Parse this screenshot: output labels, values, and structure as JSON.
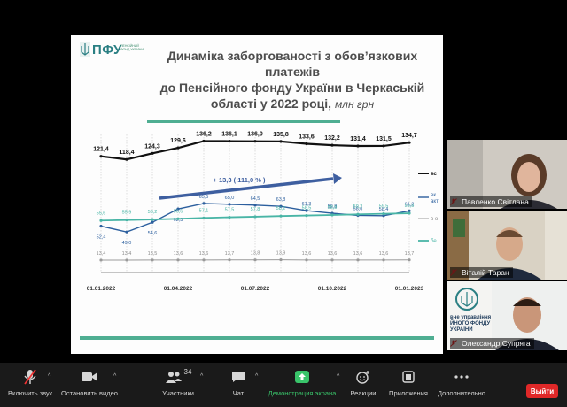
{
  "slide": {
    "logo": {
      "abbr": "ПФУ",
      "subtitle": "ПЕНСІЙНИЙ ФОНД УКРАЇНИ"
    },
    "title_line1": "Динаміка заборгованості з обов’язкових платежів",
    "title_line2": "до Пенсійного фонду України в Черкаській",
    "title_line3_main": "області у 2022 році,",
    "title_line3_unit": "млн грн",
    "growth_annotation": "+ 13,3  ( 111,0 % )",
    "legend_visible": [
      "вс",
      "ек",
      "акт",
      "в о",
      "бе"
    ]
  },
  "chart_data": {
    "type": "line",
    "x_tick_labels": [
      "01.01.2022",
      "01.04.2022",
      "01.07.2022",
      "01.10.2022",
      "01.01.2023"
    ],
    "points_per_series": 13,
    "series": [
      {
        "name": "вс",
        "color": "#111111",
        "labels": [
          "121,4",
          "118,4",
          "124,3",
          "129,6",
          "136,2",
          "136,1",
          "136,0",
          "135,8",
          "133,6",
          "132,2",
          "131,4",
          "131,5",
          "134,7"
        ],
        "values": [
          121.4,
          118.4,
          124.3,
          129.6,
          136.2,
          136.1,
          136.0,
          135.8,
          133.6,
          132.2,
          131.4,
          131.5,
          134.7
        ]
      },
      {
        "name": "ек акт",
        "color": "#2c5f9e",
        "labels": [
          "52,4",
          "49,0",
          "54,6",
          "62,3",
          "65,5",
          "65,0",
          "64,5",
          "63,8",
          "61,3",
          "59,8",
          "58,6",
          "58,4",
          "61,2"
        ],
        "values": [
          52.4,
          49.0,
          54.6,
          62.3,
          65.5,
          65.0,
          64.5,
          63.8,
          61.3,
          59.8,
          58.6,
          58.4,
          61.2
        ]
      },
      {
        "name": "бе",
        "color": "#49b5a6",
        "labels": [
          "55,6",
          "55,9",
          "56,2",
          "56,6",
          "57,1",
          "57,5",
          "57,8",
          "58,2",
          "58,5",
          "58,8",
          "59,2",
          "59,5",
          "59,8"
        ],
        "values": [
          55.6,
          55.9,
          56.2,
          56.6,
          57.1,
          57.5,
          57.8,
          58.2,
          58.5,
          58.8,
          59.2,
          59.5,
          59.8
        ]
      },
      {
        "name": "в о",
        "color": "#9a9a9a",
        "labels": [
          "13,4",
          "13,4",
          "13,5",
          "13,6",
          "13,6",
          "13,7",
          "13,8",
          "13,9",
          "13,6",
          "13,6",
          "13,6",
          "13,6",
          "13,7"
        ],
        "values": [
          13.4,
          13.4,
          13.5,
          13.6,
          13.6,
          13.7,
          13.8,
          13.9,
          13.6,
          13.6,
          13.6,
          13.6,
          13.7
        ]
      }
    ]
  },
  "participants": [
    {
      "name": "Павленко Світлана",
      "muted": true
    },
    {
      "name": "Віталій Таран",
      "muted": true
    },
    {
      "name": "Олександр Супряга",
      "muted": true,
      "bg_text_1": "вне управління",
      "bg_text_2": "ЙНОГО ФОНДУ",
      "bg_text_3": "УКРАЇНИ"
    }
  ],
  "toolbar": {
    "mute_label": "Включить звук",
    "video_label": "Остановить видео",
    "participants_label": "Участники",
    "participants_count": "34",
    "chat_label": "Чат",
    "share_label": "Демонстрация экрана",
    "reactions_label": "Реакции",
    "apps_label": "Приложения",
    "more_label": "Дополнительно",
    "leave_label": "Выйти"
  },
  "colors": {
    "accent_green": "#39c46a",
    "leave_red": "#e02828",
    "toolbar_bg": "#1a1a1a"
  }
}
